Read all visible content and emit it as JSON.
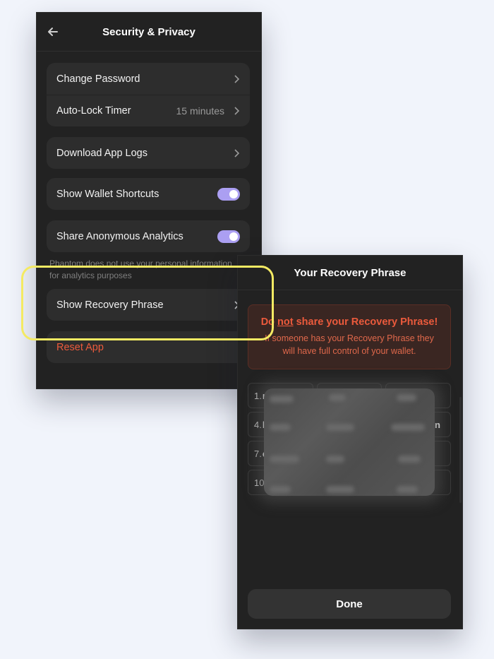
{
  "settings": {
    "title": "Security & Privacy",
    "change_password": "Change Password",
    "auto_lock_timer": "Auto-Lock Timer",
    "auto_lock_value": "15 minutes",
    "download_logs": "Download App Logs",
    "wallet_shortcuts": "Show Wallet Shortcuts",
    "wallet_shortcuts_on": true,
    "anonymous_analytics": "Share Anonymous Analytics",
    "anonymous_analytics_on": true,
    "analytics_note": "Phantom does not use your personal information for analytics purposes",
    "show_recovery": "Show Recovery Phrase",
    "reset_app": "Reset App"
  },
  "recovery": {
    "title": "Your Recovery Phrase",
    "warning_prefix": "Do ",
    "warning_emphasis": "not",
    "warning_suffix": " share your Recovery Phrase!",
    "warning_text": "If someone has your Recovery Phrase they will have full control of your wallet.",
    "words": [
      {
        "num": "1.",
        "word": "m"
      },
      {
        "num": "",
        "word": ""
      },
      {
        "num": "",
        "word": ""
      },
      {
        "num": "4.",
        "word": "b"
      },
      {
        "num": "",
        "word": ""
      },
      {
        "num": "",
        "word": "n"
      },
      {
        "num": "7.",
        "word": "e"
      },
      {
        "num": "",
        "word": ""
      },
      {
        "num": "",
        "word": ""
      },
      {
        "num": "10.",
        "word": ""
      },
      {
        "num": "",
        "word": ""
      },
      {
        "num": "",
        "word": ""
      }
    ],
    "done": "Done"
  },
  "colors": {
    "background": "#f1f4fb",
    "panel": "#222222",
    "toggle_on": "#ab9ff2",
    "danger": "#eb5a3c",
    "highlight": "#f4ea63"
  },
  "icons": {
    "back": "arrow-left-icon",
    "chevron": "chevron-right-icon"
  }
}
